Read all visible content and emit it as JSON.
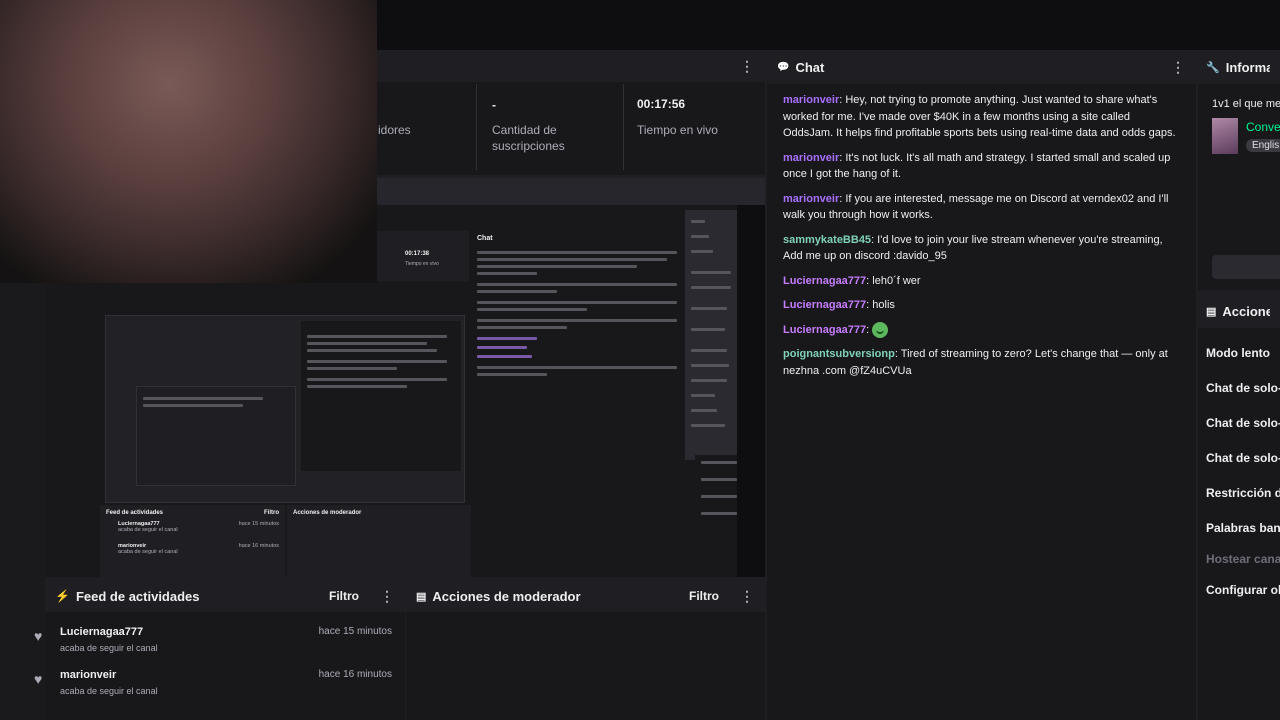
{
  "stats": {
    "partial_label": "idores",
    "subs_value": "-",
    "subs_label": "Cantidad de suscripciones",
    "live_value": "00:17:56",
    "live_label": "Tiempo en vivo"
  },
  "chat": {
    "title": "Chat",
    "messages": [
      {
        "user": "marionveir",
        "color": "#a970ff",
        "text": ": Hey, not trying to promote anything. Just wanted to share what's worked for me. I've made over $40K in a few months using a site called OddsJam. It helps find profitable sports bets using real-time data and odds gaps."
      },
      {
        "user": "marionveir",
        "color": "#a970ff",
        "text": ": It's not luck. It's all math and strategy. I started small and scaled up once I got the hang of it."
      },
      {
        "user": "marionveir",
        "color": "#a970ff",
        "text": ": If you are interested, message me on Discord at verndex02 and I'll walk you through how it works."
      },
      {
        "user": "sammykateBB45",
        "color": "#7fd1b9",
        "text": ": I'd love to join your live stream whenever you're streaming, Add me up on discord :davido_95"
      },
      {
        "user": "Luciernagaa777",
        "color": "#c77dff",
        "text": ": leh0´f wer"
      },
      {
        "user": "Luciernagaa777",
        "color": "#c77dff",
        "text": ": holis"
      },
      {
        "user": "Luciernagaa777",
        "color": "#c77dff",
        "text": ": ",
        "emote": "green-face-emote"
      },
      {
        "user": "poignantsubversionp",
        "color": "#7fd1b9",
        "text": ": Tired of streaming to zero? Let's change that — only at nezhna .com @fZ4uCVUa"
      }
    ]
  },
  "info": {
    "title": "Informació",
    "stream_title": "1v1 el que me",
    "category": "Conve",
    "tag": "Englis"
  },
  "mod_panel": {
    "title": "Acciones d",
    "items": [
      "Modo lento",
      "Chat de solo-",
      "Chat de solo-",
      "Chat de solo-",
      "Restricción d",
      "Palabras bane",
      "Hostear cana",
      "Configurar ob"
    ]
  },
  "activity": {
    "title": "Feed de actividades",
    "filter_label": "Filtro",
    "items": [
      {
        "name": "Luciernagaa777",
        "sub": "acaba de seguir el canal",
        "time": "hace 15 minutos"
      },
      {
        "name": "marionveir",
        "sub": "acaba de seguir el canal",
        "time": "hace 16 minutos"
      }
    ]
  },
  "mod_actions": {
    "title": "Acciones de moderador",
    "filter_label": "Filtro"
  },
  "nested": {
    "chat_title": "Chat",
    "live_value": "00:17:38",
    "live_label": "Tiempo en vivo",
    "activity_title": "Feed de actividades",
    "filter_label": "Filtro",
    "mod_title": "Acciones de moderador",
    "items": [
      {
        "name": "Luciernagaa777",
        "sub": "acaba de seguir el canal",
        "time": "hace 15 minutos"
      },
      {
        "name": "marionveir",
        "sub": "acaba de seguir el canal",
        "time": "hace 16 minutos"
      }
    ]
  },
  "colors": {
    "background": "#1f1f23",
    "panel": "#18181b",
    "header": "#0e0e10",
    "accent_green": "#00f593"
  }
}
